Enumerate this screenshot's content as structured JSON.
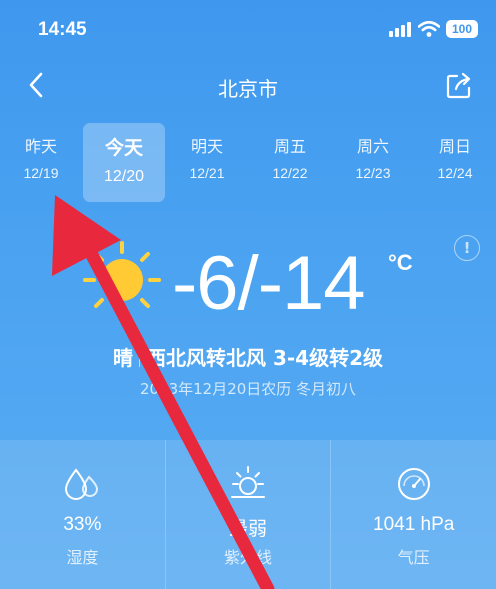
{
  "status_bar": {
    "time": "14:45",
    "battery": "100"
  },
  "nav": {
    "title": "北京市"
  },
  "day_tabs": [
    {
      "name": "昨天",
      "date": "12/19",
      "active": false
    },
    {
      "name": "今天",
      "date": "12/20",
      "active": true
    },
    {
      "name": "明天",
      "date": "12/21",
      "active": false
    },
    {
      "name": "周五",
      "date": "12/22",
      "active": false
    },
    {
      "name": "周六",
      "date": "12/23",
      "active": false
    },
    {
      "name": "周日",
      "date": "12/24",
      "active": false
    }
  ],
  "weather": {
    "icon": "sun-icon",
    "temperature": "-6/-14",
    "unit": "°C",
    "condition": "晴",
    "wind": "西北风转北风 3-4级转2级",
    "date_line": "2023年12月20日农历 冬月初八"
  },
  "details": [
    {
      "icon": "humidity-icon",
      "value": "33%",
      "label": "湿度"
    },
    {
      "icon": "uv-icon",
      "value": "最弱",
      "label": "紫外线"
    },
    {
      "icon": "pressure-gauge-icon",
      "value": "1041 hPa",
      "label": "气压"
    }
  ],
  "colors": {
    "background": "#3f98ee",
    "arrow": "#e8283c"
  }
}
